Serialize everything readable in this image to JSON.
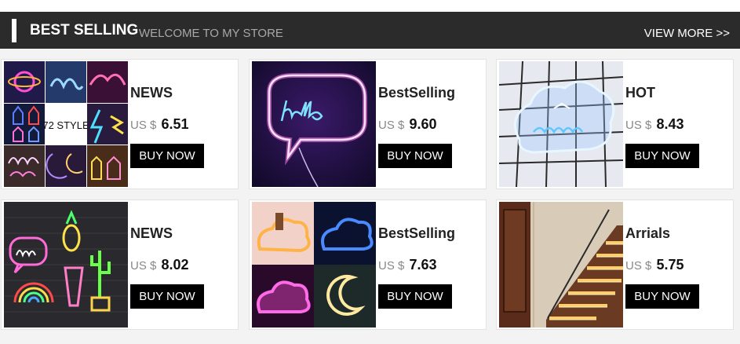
{
  "header": {
    "title": "BEST SELLING",
    "subtitle": "WELCOME TO MY STORE",
    "view_more": "VIEW MORE >>"
  },
  "currency": "US $",
  "buy_label": "BUY NOW",
  "colors": {
    "header_bg": "#2b2b2b",
    "button_bg": "#000000"
  },
  "products": [
    {
      "tag": "NEWS",
      "price": "6.51",
      "image": "neon-signs-collage-72-style",
      "image_text": "72 STYLE"
    },
    {
      "tag": "BestSelling",
      "price": "9.60",
      "image": "hello-speech-bubble-neon"
    },
    {
      "tag": "HOT",
      "price": "8.43",
      "image": "sweet-dreams-cloud-neon"
    },
    {
      "tag": "NEWS",
      "price": "8.02",
      "image": "neon-signs-on-brick-wall"
    },
    {
      "tag": "BestSelling",
      "price": "7.63",
      "image": "cloud-and-moon-neon-collage"
    },
    {
      "tag": "Arrials",
      "price": "5.75",
      "image": "led-stair-lights"
    }
  ]
}
